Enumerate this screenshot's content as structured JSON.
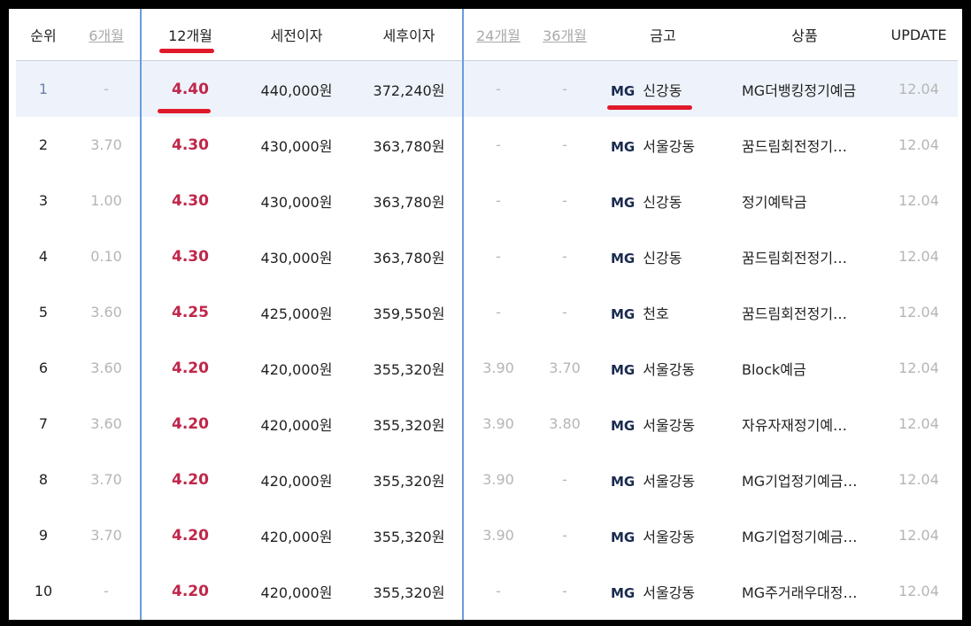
{
  "headers": {
    "rank": "순위",
    "m6": "6개월",
    "m12": "12개월",
    "pretax": "세전이자",
    "aftertax": "세후이자",
    "m24": "24개월",
    "m36": "36개월",
    "bank": "금고",
    "product": "상품",
    "update": "UPDATE"
  },
  "rows": [
    {
      "rank": "1",
      "m6": "-",
      "m12": "4.40",
      "pretax": "440,000원",
      "aftertax": "372,240원",
      "m24": "-",
      "m36": "-",
      "brand": "MG",
      "bank": "신강동",
      "product": "MG더뱅킹정기예금",
      "update": "12.04"
    },
    {
      "rank": "2",
      "m6": "3.70",
      "m12": "4.30",
      "pretax": "430,000원",
      "aftertax": "363,780원",
      "m24": "-",
      "m36": "-",
      "brand": "MG",
      "bank": "서울강동",
      "product": "꿈드림회전정기…",
      "update": "12.04"
    },
    {
      "rank": "3",
      "m6": "1.00",
      "m12": "4.30",
      "pretax": "430,000원",
      "aftertax": "363,780원",
      "m24": "-",
      "m36": "-",
      "brand": "MG",
      "bank": "신강동",
      "product": "정기예탁금",
      "update": "12.04"
    },
    {
      "rank": "4",
      "m6": "0.10",
      "m12": "4.30",
      "pretax": "430,000원",
      "aftertax": "363,780원",
      "m24": "-",
      "m36": "-",
      "brand": "MG",
      "bank": "신강동",
      "product": "꿈드림회전정기…",
      "update": "12.04"
    },
    {
      "rank": "5",
      "m6": "3.60",
      "m12": "4.25",
      "pretax": "425,000원",
      "aftertax": "359,550원",
      "m24": "-",
      "m36": "-",
      "brand": "MG",
      "bank": "천호",
      "product": "꿈드림회전정기…",
      "update": "12.04"
    },
    {
      "rank": "6",
      "m6": "3.60",
      "m12": "4.20",
      "pretax": "420,000원",
      "aftertax": "355,320원",
      "m24": "3.90",
      "m36": "3.70",
      "brand": "MG",
      "bank": "서울강동",
      "product": "Block예금",
      "update": "12.04"
    },
    {
      "rank": "7",
      "m6": "3.60",
      "m12": "4.20",
      "pretax": "420,000원",
      "aftertax": "355,320원",
      "m24": "3.90",
      "m36": "3.80",
      "brand": "MG",
      "bank": "서울강동",
      "product": "자유자재정기예…",
      "update": "12.04"
    },
    {
      "rank": "8",
      "m6": "3.70",
      "m12": "4.20",
      "pretax": "420,000원",
      "aftertax": "355,320원",
      "m24": "3.90",
      "m36": "-",
      "brand": "MG",
      "bank": "서울강동",
      "product": "MG기업정기예금…",
      "update": "12.04"
    },
    {
      "rank": "9",
      "m6": "3.70",
      "m12": "4.20",
      "pretax": "420,000원",
      "aftertax": "355,320원",
      "m24": "3.90",
      "m36": "-",
      "brand": "MG",
      "bank": "서울강동",
      "product": "MG기업정기예금…",
      "update": "12.04"
    },
    {
      "rank": "10",
      "m6": "-",
      "m12": "4.20",
      "pretax": "420,000원",
      "aftertax": "355,320원",
      "m24": "-",
      "m36": "-",
      "brand": "MG",
      "bank": "서울강동",
      "product": "MG주거래우대정…",
      "update": "12.04"
    }
  ],
  "colors": {
    "rate": "#c0264a",
    "highlight_row": "#eef3fb",
    "column_box": "#6a9be0",
    "annotation_red": "#e0192b"
  }
}
